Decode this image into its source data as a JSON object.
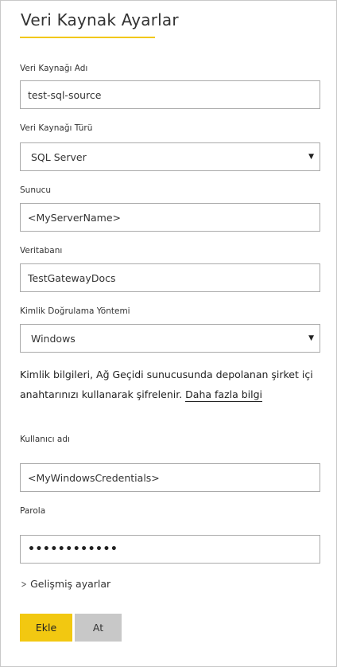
{
  "dialog": {
    "title": "Veri Kaynak Ayarlar"
  },
  "fields": {
    "datasource_name": {
      "label": "Veri Kaynağı Adı",
      "value": "test-sql-source"
    },
    "datasource_type": {
      "label": "Veri Kaynağı Türü",
      "value": "SQL Server"
    },
    "server": {
      "label": "Sunucu",
      "value": "<MyServerName>"
    },
    "database": {
      "label": "Veritabanı",
      "value": "TestGatewayDocs"
    },
    "auth_method": {
      "label": "Kimlik Doğrulama Yöntemi",
      "value": "Windows"
    },
    "username": {
      "label": "Kullanıcı adı",
      "value": "<MyWindowsCredentials>"
    },
    "password": {
      "label": "Parola",
      "value": "••••••••••••"
    }
  },
  "info": {
    "text": "Kimlik bilgileri, Ağ Geçidi sunucusunda depolanan şirket içi anahtarınızı kullanarak şifrelenir.",
    "link": "Daha fazla bilgi"
  },
  "advanced": {
    "label": "Gelişmiş ayarlar"
  },
  "buttons": {
    "add": "Ekle",
    "discard": "At"
  }
}
